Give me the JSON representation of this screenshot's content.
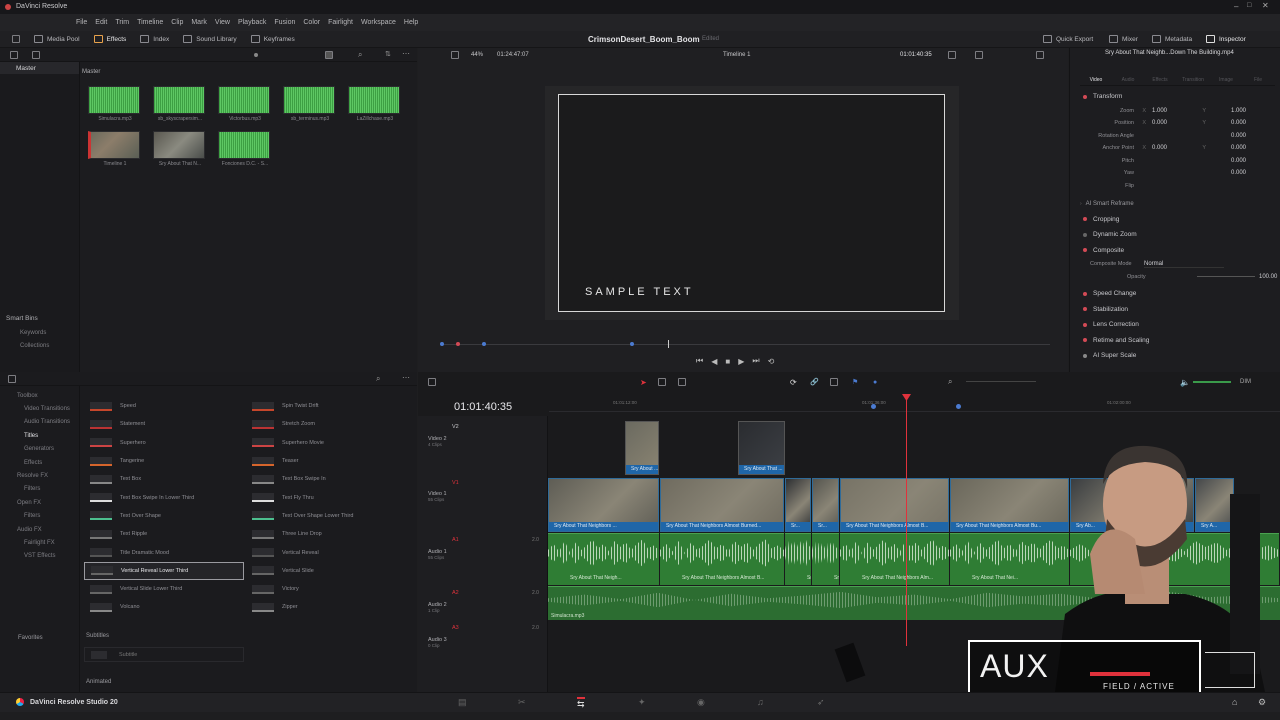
{
  "app": {
    "name": "DaVinci Resolve",
    "project_title": "CrimsonDesert_Boom_Boom",
    "project_status": "Edited",
    "version_label": "DaVinci Resolve Studio 20"
  },
  "menubar": [
    "File",
    "Edit",
    "Trim",
    "Timeline",
    "Clip",
    "Mark",
    "View",
    "Playback",
    "Fusion",
    "Color",
    "Fairlight",
    "Workspace",
    "Help"
  ],
  "toolbar": {
    "left": [
      "Media Pool",
      "Effects",
      "Index",
      "Sound Library",
      "Keyframes"
    ],
    "right": [
      "Quick Export",
      "Mixer",
      "Metadata",
      "Inspector"
    ]
  },
  "media_pool": {
    "bin_header": "Master",
    "folder_label": "Master",
    "smart_bins_label": "Smart Bins",
    "smart_bins": [
      "Keywords",
      "Collections"
    ],
    "clips": [
      {
        "name": "Simulacra.mp3",
        "kind": "audio"
      },
      {
        "name": "sb_skyscrapersim...",
        "kind": "audio"
      },
      {
        "name": "Victorbus.mp3",
        "kind": "audio"
      },
      {
        "name": "sb_terminus.mp3",
        "kind": "audio"
      },
      {
        "name": "LaZillchase.mp3",
        "kind": "audio"
      },
      {
        "name": "Timeline 1",
        "kind": "timeline"
      },
      {
        "name": "Sry About That N...",
        "kind": "video"
      },
      {
        "name": "Fonciones D.C. - S...",
        "kind": "audio"
      }
    ]
  },
  "viewer": {
    "zoom": "44%",
    "source_timecode": "01:24:47:07",
    "timeline_name": "Timeline 1",
    "record_timecode": "01:01:40:35",
    "sample_text": "SAMPLE TEXT"
  },
  "inspector": {
    "clip_name": "Sry About That Neighb...Down The Building.mp4",
    "tabs": [
      "Video",
      "Audio",
      "Effects",
      "Transition",
      "Image",
      "File"
    ],
    "transform_label": "Transform",
    "properties": [
      {
        "label": "Zoom",
        "x": "1.000",
        "y": "1.000"
      },
      {
        "label": "Position",
        "x": "0.000",
        "y": "0.000"
      },
      {
        "label": "Rotation Angle",
        "x": "",
        "y": "0.000"
      },
      {
        "label": "Anchor Point",
        "x": "0.000",
        "y": "0.000"
      },
      {
        "label": "Pitch",
        "x": "",
        "y": "0.000"
      },
      {
        "label": "Yaw",
        "x": "",
        "y": "0.000"
      },
      {
        "label": "Flip",
        "x": "",
        "y": ""
      }
    ],
    "sections_a": [
      "AI Smart Reframe",
      "Cropping",
      "Dynamic Zoom",
      "Composite"
    ],
    "composite_mode_label": "Composite Mode",
    "composite_mode_value": "Normal",
    "opacity_label": "Opacity",
    "opacity_value": "100.00",
    "sections_b": [
      "Speed Change",
      "Stabilization",
      "Lens Correction",
      "Retime and Scaling",
      "AI Super Scale"
    ]
  },
  "effects_library": {
    "tree": [
      "Toolbox",
      "Video Transitions",
      "Audio Transitions",
      "Titles",
      "Generators",
      "Effects",
      "Resolve FX",
      "Filters",
      "Open FX",
      "Filters",
      "Audio FX",
      "Fairlight FX",
      "VST Effects"
    ],
    "favorites_label": "Favorites",
    "titles_col1": [
      "Speed",
      "Statement",
      "Superhero",
      "Tangerine",
      "Text Box",
      "Text Box Swipe In Lower Third",
      "Text Over Shape",
      "Text Ripple",
      "Title Dramatic Mood",
      "Vertical Reveal Lower Third",
      "Vertical Slide Lower Third",
      "Volcano"
    ],
    "titles_col2": [
      "Spin Twist Drift",
      "Stretch Zoom",
      "Superhero Movie",
      "Teaser",
      "Text Box Swipe In",
      "Text Fly Thru",
      "Text Over Shape Lower Third",
      "Three Line Drop",
      "Vertical Reveal",
      "Vertical Slide",
      "Victory",
      "Zipper"
    ],
    "selected_title": "Vertical Reveal Lower Third",
    "subtitles_label": "Subtitles",
    "subtitle_item": "Subtitle",
    "animated_label": "Animated"
  },
  "timeline": {
    "timecode": "01:01:40:35",
    "ruler": [
      "01:01:12:00",
      "01:01:36:00",
      "01:02:00:00"
    ],
    "tracks": [
      {
        "id": "V2",
        "name": "Video 2",
        "clips": "4 Clips"
      },
      {
        "id": "V1",
        "name": "Video 1",
        "clips": "55 Clips"
      },
      {
        "id": "A1",
        "name": "Audio 1",
        "clips": "55 Clips",
        "level": "2.0"
      },
      {
        "id": "A2",
        "name": "Audio 2",
        "clips": "1 Clip",
        "level": "2.0"
      },
      {
        "id": "A3",
        "name": "Audio 3",
        "clips": "0 Clip",
        "level": "2.0"
      }
    ],
    "v2_clips": [
      "Sry About ...",
      "Sry About That ..."
    ],
    "v1_clips": [
      "Sry About That Neighbors ...",
      "Sry About That Neighbors Almost Burned...",
      "Sr...",
      "Sr...",
      "Sry About That Neighbors Almost B...",
      "Sry About That Neighbors Almost Bu...",
      "Sry Ab...",
      "Sry A..."
    ],
    "a1_clips": [
      "Sry About That Neigh...",
      "Sry About That Neighbors Almost B...",
      "Sr...",
      "Sr...",
      "Sry About That Neighbors Alm...",
      "Sry About That Nei..."
    ],
    "a2_clip": "Simulacra.mp3",
    "audio_meter_label": "DIM"
  },
  "overlay": {
    "title": "AUX",
    "subtitle": "FIELD / ACTIVE"
  },
  "colors": {
    "accent_red": "#d24a55",
    "video_clip_blue": "#1f66a8",
    "audio_clip_green": "#2f7d34",
    "playhead": "#e0323c"
  }
}
